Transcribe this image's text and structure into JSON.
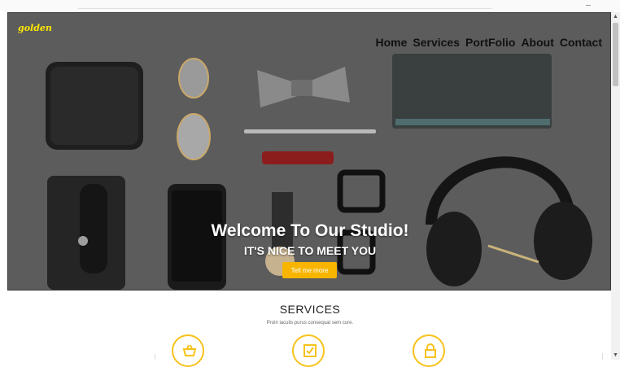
{
  "brand": {
    "logo": "golden"
  },
  "nav": {
    "items": [
      "Home",
      "Services",
      "PortFolio",
      "About",
      "Contact"
    ]
  },
  "hero": {
    "title": "Welcome To Our Studio!",
    "subtitle": "IT'S NICE TO MEET YOU",
    "button": "Tell me more"
  },
  "services": {
    "title": "SERVICES",
    "subtitle": "Proin iaculis purus consequat sem cure.",
    "icons": [
      "shopping-basket-icon",
      "checkbox-icon",
      "lock-icon"
    ]
  },
  "colors": {
    "accent": "#f7b500",
    "logo": "#ffe600",
    "icon_ring": "#f7c21a"
  }
}
